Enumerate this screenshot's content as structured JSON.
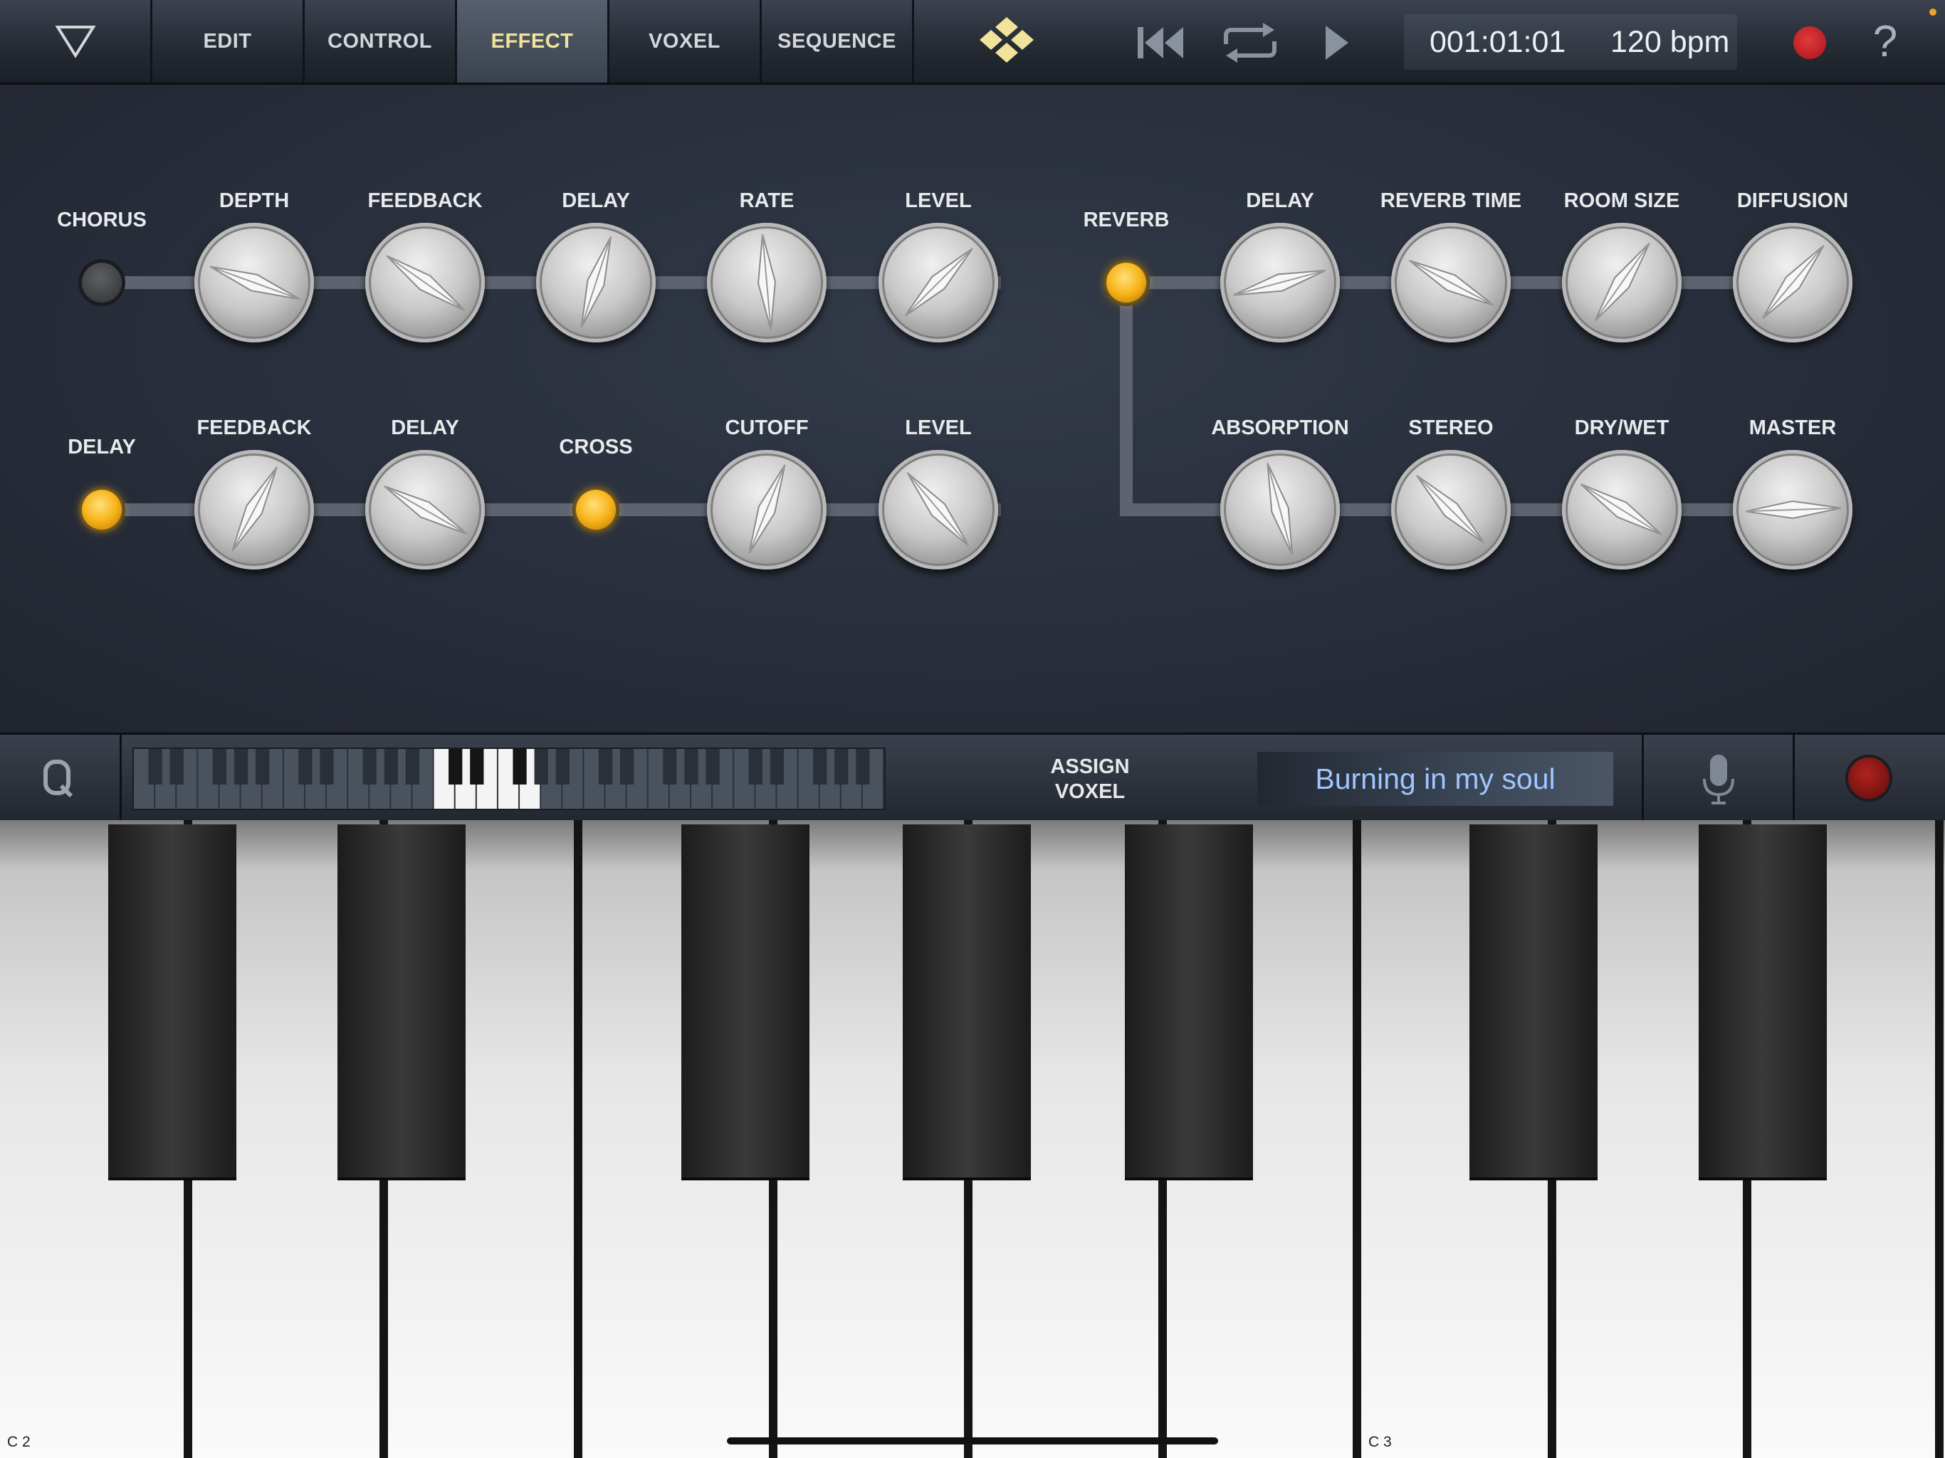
{
  "top_bar": {
    "tabs": [
      {
        "label": "EDIT"
      },
      {
        "label": "CONTROL"
      },
      {
        "label": "EFFECT"
      },
      {
        "label": "VOXEL"
      },
      {
        "label": "SEQUENCE"
      }
    ],
    "active_tab": "EFFECT",
    "time": "001:01:01",
    "tempo": "120 bpm",
    "icons": {
      "menu": "triangle-down-icon",
      "logo": "diamond-logo-icon",
      "rewind": "skip-back-icon",
      "loop": "loop-icon",
      "play": "play-icon",
      "record": "record-icon",
      "help": "help-icon"
    },
    "help_glyph": "?"
  },
  "effects": {
    "chorus": {
      "name": "CHORUS",
      "enabled": false,
      "params": [
        {
          "label": "DEPTH"
        },
        {
          "label": "FEEDBACK"
        },
        {
          "label": "DELAY"
        },
        {
          "label": "RATE"
        },
        {
          "label": "LEVEL"
        }
      ]
    },
    "delay": {
      "name": "DELAY",
      "enabled": true,
      "params": [
        {
          "label": "FEEDBACK"
        },
        {
          "label": "DELAY"
        }
      ],
      "cross": {
        "label": "CROSS",
        "enabled": true
      },
      "params2": [
        {
          "label": "CUTOFF"
        },
        {
          "label": "LEVEL"
        }
      ]
    },
    "reverb": {
      "name": "REVERB",
      "enabled": true,
      "params": [
        {
          "label": "DELAY"
        },
        {
          "label": "REVERB TIME"
        },
        {
          "label": "ROOM SIZE"
        },
        {
          "label": "DIFFUSION"
        }
      ],
      "params2": [
        {
          "label": "ABSORPTION"
        },
        {
          "label": "STEREO"
        },
        {
          "label": "DRY/WET"
        },
        {
          "label": "MASTER"
        }
      ]
    }
  },
  "strip": {
    "assign_line1": "ASSIGN",
    "assign_line2": "VOXEL",
    "song": "Burning in my soul",
    "icons": {
      "quantize": "q-icon",
      "mic": "microphone-icon",
      "record": "record-icon"
    }
  },
  "keyboard": {
    "note_low": "C 2",
    "note_high": "C 3"
  },
  "colors": {
    "active_tab_text": "#f3e39a",
    "led_on": "#f7b319",
    "song_text": "#9ec6ff",
    "record": "#c0161b"
  }
}
